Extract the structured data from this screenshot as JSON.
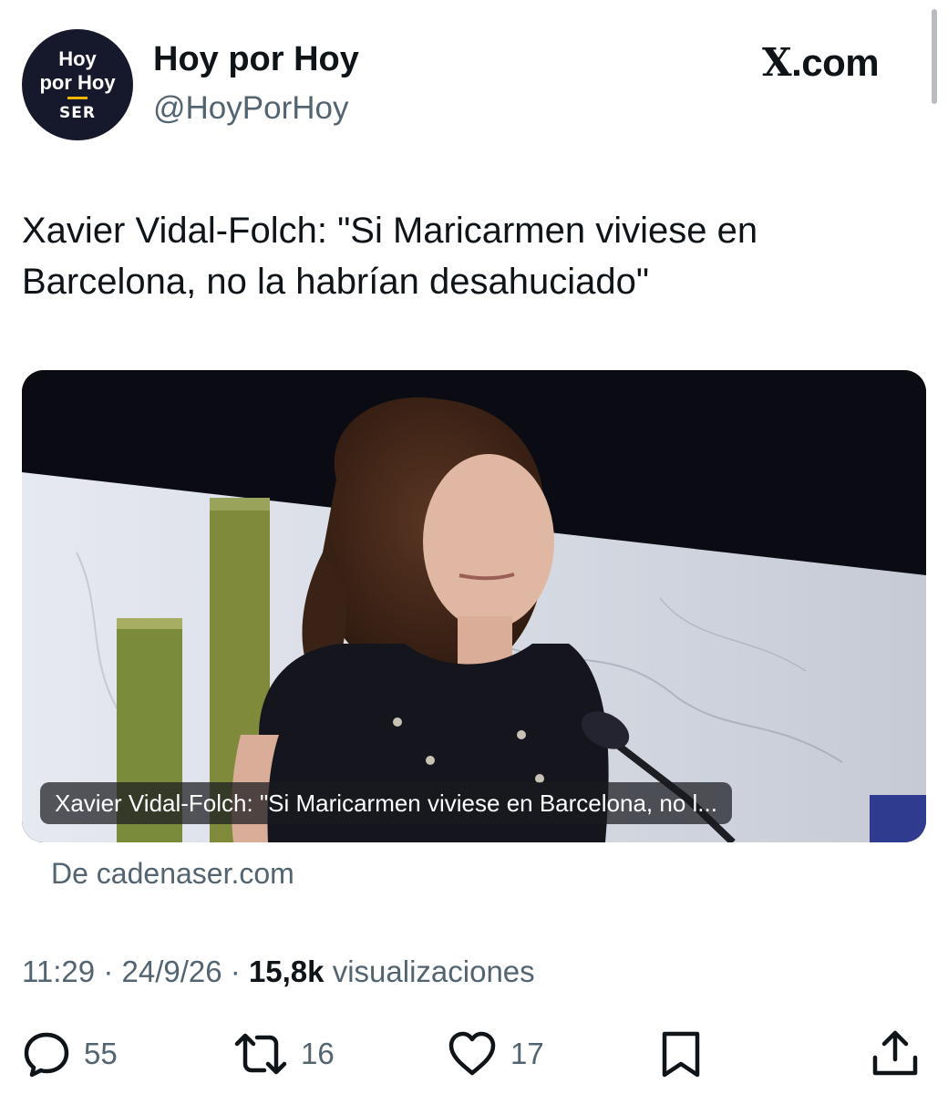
{
  "author": {
    "display_name": "Hoy por Hoy",
    "handle": "@HoyPorHoy",
    "avatar": {
      "line1": "Hoy",
      "line2": "por Hoy",
      "brand": "SER",
      "brand_color": "#15192b",
      "accent_color": "#f2b705"
    }
  },
  "site_logo": "X.com",
  "tweet": {
    "text": "Xavier Vidal-Folch: \"Si Maricarmen viviese en Barcelona, no la habrían desahuciado\""
  },
  "link_card": {
    "image_icon": "news-photo",
    "caption": "Xavier Vidal-Folch: \"Si Maricarmen viviese en Barcelona, no l...",
    "source": "De cadenaser.com"
  },
  "meta": {
    "time": "11:29",
    "date": "24/9/26",
    "views_count": "15,8k",
    "views_label": "visualizaciones"
  },
  "actions": {
    "replies": {
      "icon": "reply-icon",
      "count": "55"
    },
    "reposts": {
      "icon": "repost-icon",
      "count": "16"
    },
    "likes": {
      "icon": "heart-icon",
      "count": "17"
    },
    "bookmark": {
      "icon": "bookmark-icon"
    },
    "share": {
      "icon": "share-icon"
    }
  },
  "colors": {
    "text": "#0f1419",
    "secondary": "#536471"
  }
}
